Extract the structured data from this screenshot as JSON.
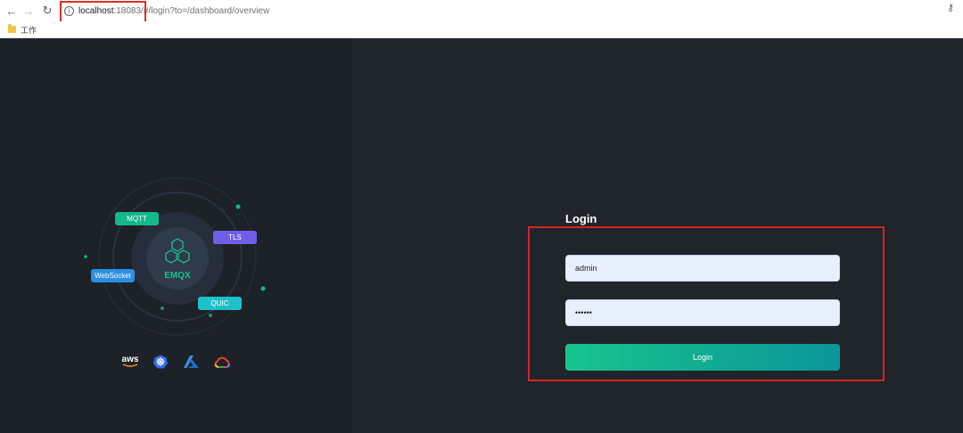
{
  "browser": {
    "url_host": "localhost",
    "url_port": ":18083/#/",
    "url_path": "login?to=/dashboard/overview",
    "bookmark_folder": "工作"
  },
  "hero": {
    "brand": "EMQX",
    "protocols": [
      "MQTT",
      "TLS",
      "WebSocket",
      "QUIC"
    ],
    "clouds": [
      "aws",
      "kubernetes-icon",
      "azure-icon",
      "google-cloud-icon"
    ]
  },
  "login": {
    "title": "Login",
    "username_value": "admin",
    "password_value": "public",
    "button_label": "Login"
  },
  "colors": {
    "accent": "#10b991",
    "highlight_red": "#d9302a"
  }
}
